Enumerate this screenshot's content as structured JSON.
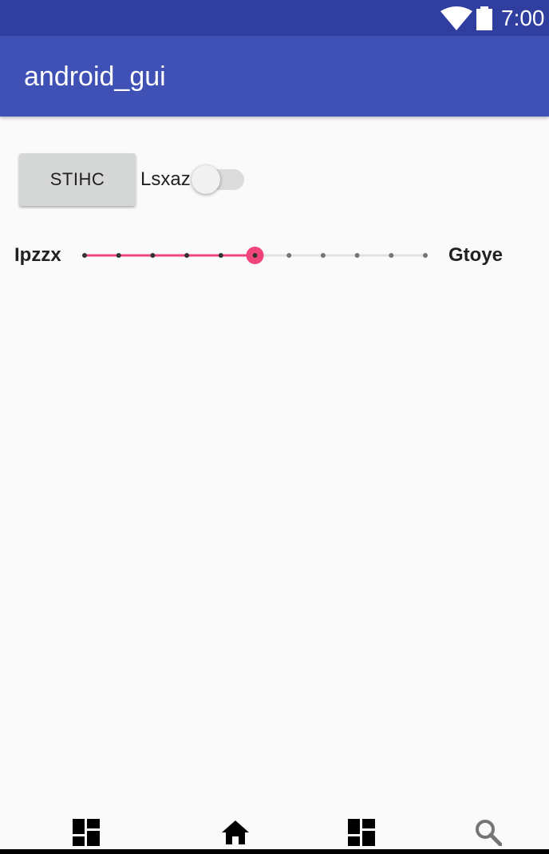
{
  "status_bar": {
    "time": "7:00",
    "icons": [
      "wifi-icon",
      "battery-icon"
    ]
  },
  "app_bar": {
    "title": "android_gui"
  },
  "content": {
    "button": {
      "label": "STIHC"
    },
    "switch": {
      "label": "Lsxaz",
      "checked": false
    },
    "seekbar": {
      "min_label": "Ipzzx",
      "max_label": "Gtoye",
      "tick_count": 11,
      "value": 5,
      "max": 10,
      "active_color": "#f0457a",
      "inactive_tick_color": "#757575"
    }
  },
  "bottom_nav": {
    "items": [
      {
        "icon": "dashboard-icon"
      },
      {
        "icon": "home-icon"
      },
      {
        "icon": "dashboard-icon"
      },
      {
        "icon": "search-icon"
      }
    ]
  }
}
